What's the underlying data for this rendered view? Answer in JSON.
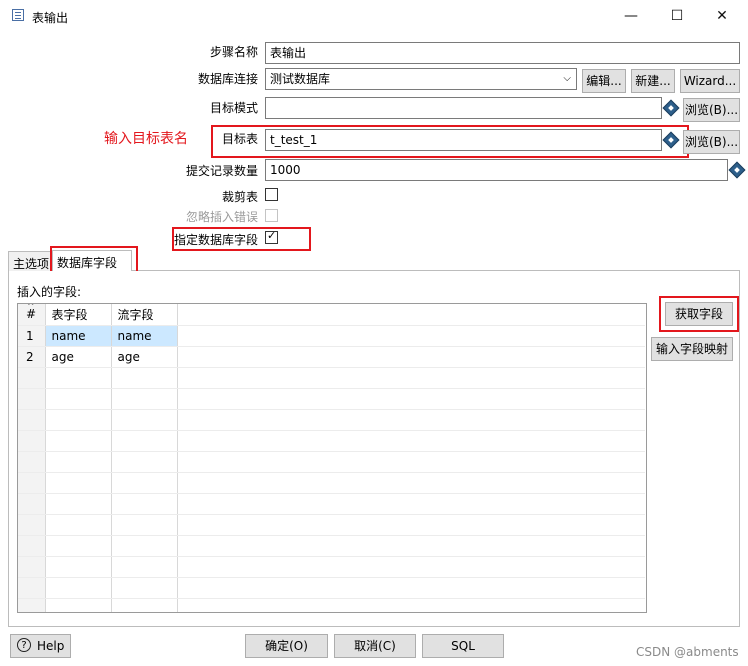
{
  "window": {
    "title": "表输出",
    "controls": {
      "minimize": "—",
      "maximize": "☐",
      "close": "✕"
    },
    "icon": "table-output-icon"
  },
  "form": {
    "step_name": {
      "label": "步骤名称",
      "value": "表输出"
    },
    "db_connection": {
      "label": "数据库连接",
      "value": "测试数据库",
      "edit_button": "编辑...",
      "new_button": "新建...",
      "wizard_button": "Wizard..."
    },
    "target_schema": {
      "label": "目标模式",
      "value": "",
      "browse_button": "浏览(B)..."
    },
    "target_table": {
      "label": "目标表",
      "value": "t_test_1",
      "browse_button": "浏览(B)..."
    },
    "commit_size": {
      "label": "提交记录数量",
      "value": "1000"
    },
    "truncate_table": {
      "label": "裁剪表",
      "checked": false
    },
    "ignore_errors": {
      "label": "忽略插入错误",
      "checked": false,
      "disabled": true
    },
    "specify_db_fields": {
      "label": "指定数据库字段",
      "checked": true
    }
  },
  "annotation": {
    "text": "输入目标表名",
    "color": "#e3171d"
  },
  "tabs": [
    {
      "label": "主选项",
      "active": false
    },
    {
      "label": "数据库字段",
      "active": true
    }
  ],
  "fields_panel": {
    "title": "插入的字段:",
    "columns": [
      "#",
      "表字段",
      "流字段"
    ],
    "rows": [
      [
        "1",
        "name",
        "name"
      ],
      [
        "2",
        "age",
        "age"
      ]
    ],
    "get_fields_button": "获取字段",
    "enter_mapping_button": "输入字段映射"
  },
  "footer": {
    "help": "Help",
    "ok": "确定(O)",
    "cancel": "取消(C)",
    "sql": "SQL"
  },
  "watermark": "CSDN @abments"
}
